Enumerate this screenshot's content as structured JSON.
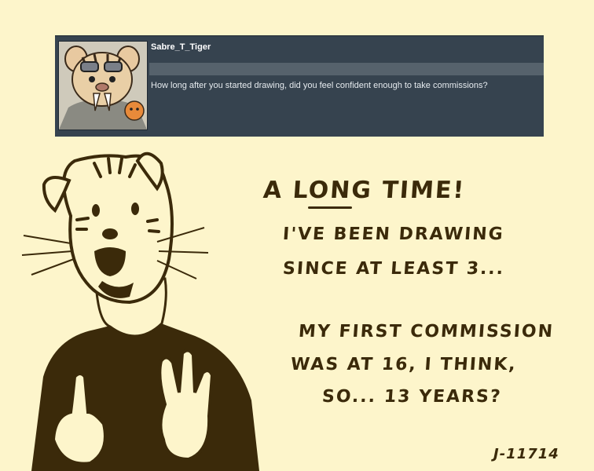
{
  "ask": {
    "username": "Sabre_T_Tiger",
    "question": "How long after you started drawing, did you feel confident enough to take commissions?"
  },
  "answer": {
    "line1": "A LONG TIME!",
    "line2": "I'VE BEEN DRAWING",
    "line3": "SINCE AT LEAST 3...",
    "line4": "MY FIRST COMMISSION",
    "line5": "WAS AT 16, I THINK,",
    "line6": "SO... 13 YEARS?"
  },
  "signature": "J-11714",
  "colors": {
    "page_background": "#fdf5cb",
    "ask_box": "#36434f",
    "ink": "#3b2a0a"
  }
}
